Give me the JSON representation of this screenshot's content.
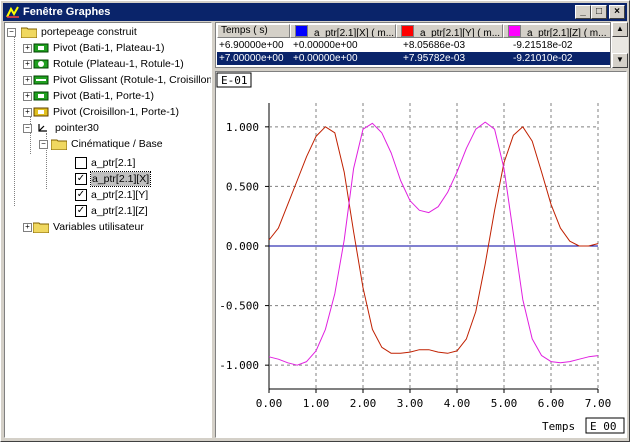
{
  "window": {
    "title": "Fenêtre Graphes",
    "minimize": "_",
    "maximize": "□",
    "close": "×"
  },
  "tree": {
    "root": "portepeage construit",
    "items": [
      {
        "label": "Pivot (Bati-1, Plateau-1)",
        "icon": "pivot-joint-icon"
      },
      {
        "label": "Rotule (Plateau-1, Rotule-1)",
        "icon": "ball-joint-icon"
      },
      {
        "label": "Pivot Glissant (Rotule-1, Croisillon-1)",
        "icon": "cylindrical-joint-icon"
      },
      {
        "label": "Pivot (Bati-1, Porte-1)",
        "icon": "pivot-joint-icon"
      },
      {
        "label": "Pivot (Croisillon-1, Porte-1)",
        "icon": "pivot-joint-yellow-icon"
      }
    ],
    "pointer": "pointer30",
    "folder": "Cinématique / Base",
    "channels": [
      {
        "label": "a_ptr[2.1]",
        "checked": false
      },
      {
        "label": "a_ptr[2.1][X]",
        "checked": true,
        "selected": true
      },
      {
        "label": "a_ptr[2.1][Y]",
        "checked": true
      },
      {
        "label": "a_ptr[2.1][Z]",
        "checked": true
      }
    ],
    "user_vars": "Variables utilisateur"
  },
  "table": {
    "headers": [
      "Temps ( s)",
      "a_ptr[2.1][X] ( m...",
      "a_ptr[2.1][Y] ( m...",
      "a_ptr[2.1][Z] ( m..."
    ],
    "header_colors": [
      "",
      "#0000ff",
      "#ff0000",
      "#ff00ff"
    ],
    "rows": [
      [
        "+6.90000e+00",
        "+0.00000e+00",
        "+8.05686e-03",
        "-9.21518e-02"
      ],
      [
        "+7.00000e+00",
        "+0.00000e+00",
        "+7.95782e-03",
        "-9.21010e-02"
      ]
    ],
    "selected_row": 1
  },
  "chart_data": {
    "type": "line",
    "title": "",
    "xlabel": "Temps",
    "y_exponent_label": "E-01",
    "x_exponent_label": "E 00",
    "xlim": [
      0,
      7
    ],
    "ylim": [
      -1.2,
      1.2
    ],
    "xticks": [
      "0.00",
      "1.00",
      "2.00",
      "3.00",
      "4.00",
      "5.00",
      "6.00",
      "7.00"
    ],
    "yticks": [
      "1.000",
      "0.500",
      "0.000",
      "-0.500",
      "-1.000"
    ],
    "ytick_values": [
      1.0,
      0.5,
      0.0,
      -0.5,
      -1.0
    ],
    "grid": true,
    "series": [
      {
        "color": "#0000a0",
        "x": [
          0,
          7
        ],
        "y": [
          0,
          0
        ]
      },
      {
        "color": "#c02000",
        "x": [
          0,
          0.2,
          0.4,
          0.6,
          0.8,
          1.0,
          1.2,
          1.4,
          1.6,
          1.8,
          2.0,
          2.2,
          2.4,
          2.6,
          2.8,
          3.0,
          3.2,
          3.4,
          3.6,
          3.8,
          4.0,
          4.2,
          4.4,
          4.6,
          4.8,
          5.0,
          5.2,
          5.4,
          5.6,
          5.8,
          6.0,
          6.2,
          6.4,
          6.6,
          6.8,
          7.0
        ],
        "y": [
          0.05,
          0.15,
          0.35,
          0.55,
          0.75,
          0.92,
          1.0,
          0.95,
          0.62,
          0.12,
          -0.35,
          -0.7,
          -0.85,
          -0.9,
          -0.9,
          -0.89,
          -0.87,
          -0.87,
          -0.89,
          -0.9,
          -0.88,
          -0.78,
          -0.55,
          -0.15,
          0.3,
          0.7,
          0.93,
          1.0,
          0.88,
          0.62,
          0.35,
          0.15,
          0.04,
          0.0,
          0.0,
          0.02
        ]
      },
      {
        "color": "#e020e0",
        "x": [
          0,
          0.2,
          0.4,
          0.6,
          0.8,
          1.0,
          1.2,
          1.4,
          1.6,
          1.8,
          2.0,
          2.2,
          2.4,
          2.6,
          2.8,
          3.0,
          3.2,
          3.4,
          3.6,
          3.8,
          4.0,
          4.2,
          4.4,
          4.6,
          4.8,
          5.0,
          5.2,
          5.4,
          5.6,
          5.8,
          6.0,
          6.2,
          6.4,
          6.6,
          6.8,
          7.0
        ],
        "y": [
          -0.93,
          -0.95,
          -0.98,
          -1.0,
          -0.97,
          -0.88,
          -0.7,
          -0.4,
          0.05,
          0.65,
          0.98,
          1.03,
          0.95,
          0.78,
          0.55,
          0.38,
          0.3,
          0.28,
          0.33,
          0.45,
          0.62,
          0.82,
          0.98,
          1.04,
          0.98,
          0.65,
          0.1,
          -0.45,
          -0.78,
          -0.92,
          -0.97,
          -0.98,
          -0.97,
          -0.95,
          -0.93,
          -0.92
        ]
      }
    ]
  }
}
